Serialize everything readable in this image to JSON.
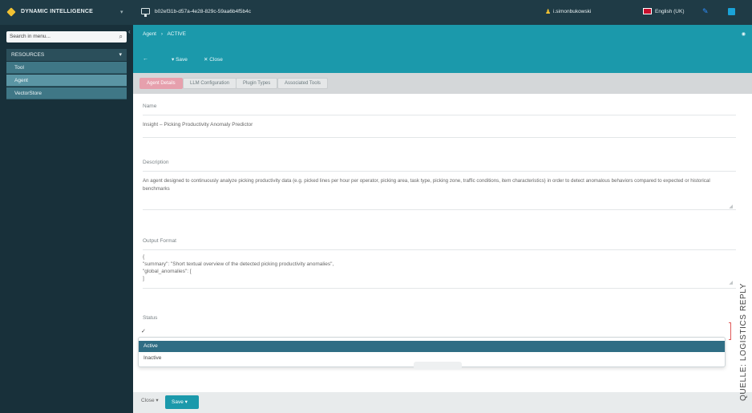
{
  "topbar": {
    "brand": "DYNAMIC INTELLIGENCE",
    "session": "b02ef31b-d57a-4e28-829c-59aa6b4f5b4c",
    "user": "i.simonbukowski",
    "language": "English (UK)"
  },
  "sidebar": {
    "search_placeholder": "Search in menu...",
    "resources_label": "RESOURCES",
    "items": [
      {
        "label": "Tool"
      },
      {
        "label": "Agent"
      },
      {
        "label": "VectorStore"
      }
    ]
  },
  "header": {
    "breadcrumb_root": "Agent",
    "breadcrumb_current": "ACTIVE",
    "back_label": "←",
    "save_action": "Save",
    "close_action": "Close"
  },
  "tabs": [
    "Agent Details",
    "LLM Configuration",
    "Plugin Types",
    "Associated Tools"
  ],
  "form": {
    "name_label": "Name",
    "name_value": "Insight – Picking Productivity Anomaly Predictor",
    "description_label": "Description",
    "description_value": "An agent designed to continuously analyze picking productivity data (e.g. picked lines per hour per operator, picking area, task type, picking zone, traffic conditions, item characteristics) in order to detect anomalous behaviors compared to expected or historical benchmarks",
    "output_label": "Output Format",
    "output_lines": [
      "{",
      "\"summary\": \"Short textual overview of the detected picking productivity anomalies\",",
      "\"global_anomalies\": [",
      "]"
    ],
    "status_label": "Status",
    "status_selected": "✓",
    "status_options": [
      "Active",
      "Inactive"
    ]
  },
  "bottom": {
    "cancel_label": "Close",
    "save_label": "Save"
  },
  "watermark": "QUELLE: LOGISTICS REPLY"
}
